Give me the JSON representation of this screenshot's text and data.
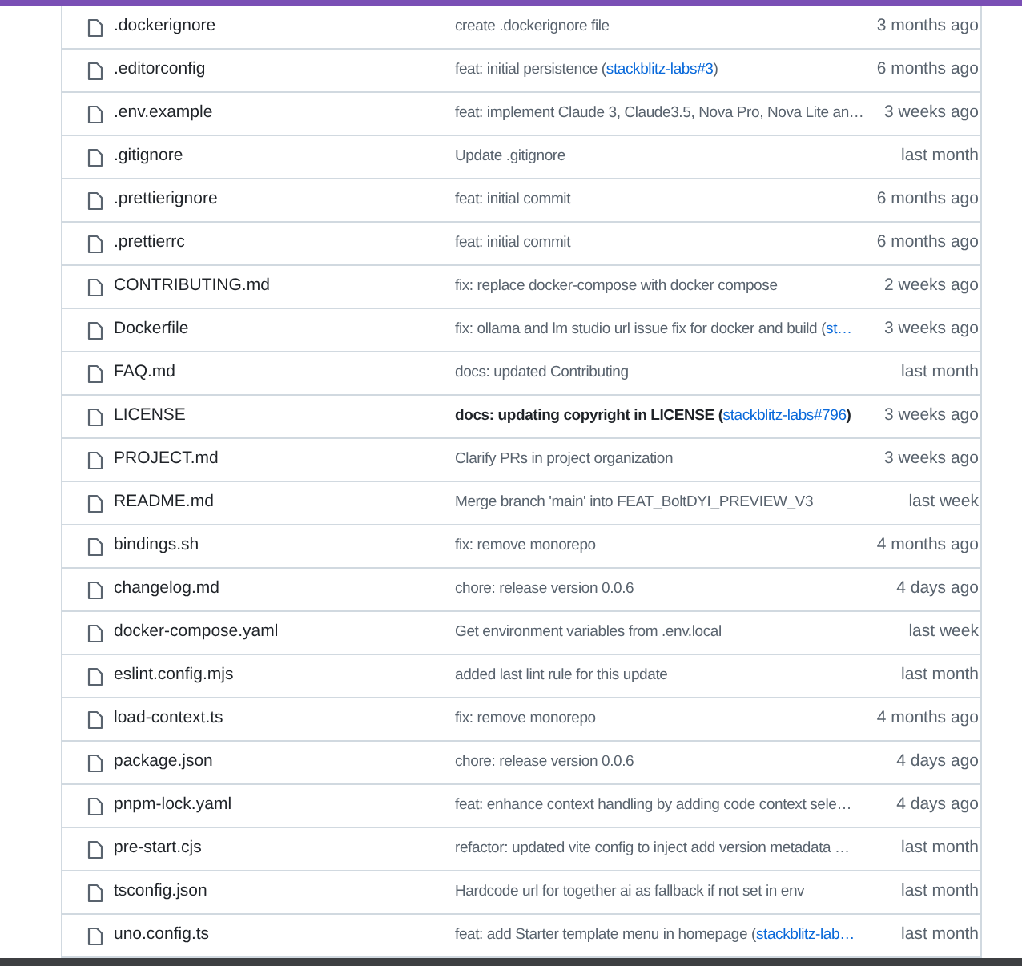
{
  "files": [
    {
      "name": ".dockerignore",
      "commit": [
        {
          "text": "create .dockerignore file"
        }
      ],
      "time": "3 months ago"
    },
    {
      "name": ".editorconfig",
      "commit": [
        {
          "text": "feat: initial persistence ("
        },
        {
          "text": "stackblitz-labs#3",
          "link": true
        },
        {
          "text": ")"
        }
      ],
      "time": "6 months ago"
    },
    {
      "name": ".env.example",
      "commit": [
        {
          "text": "feat: implement Claude 3, Claude3.5, Nova Pro, Nova Lite an…"
        }
      ],
      "time": "3 weeks ago"
    },
    {
      "name": ".gitignore",
      "commit": [
        {
          "text": "Update .gitignore"
        }
      ],
      "time": "last month"
    },
    {
      "name": ".prettierignore",
      "commit": [
        {
          "text": "feat: initial commit"
        }
      ],
      "time": "6 months ago"
    },
    {
      "name": ".prettierrc",
      "commit": [
        {
          "text": "feat: initial commit"
        }
      ],
      "time": "6 months ago"
    },
    {
      "name": "CONTRIBUTING.md",
      "commit": [
        {
          "text": "fix: replace docker-compose with docker compose"
        }
      ],
      "time": "2 weeks ago"
    },
    {
      "name": "Dockerfile",
      "commit": [
        {
          "text": "fix: ollama and lm studio url issue fix for docker and build ("
        },
        {
          "text": "st…",
          "link": true
        }
      ],
      "time": "3 weeks ago"
    },
    {
      "name": "FAQ.md",
      "commit": [
        {
          "text": "docs: updated Contributing"
        }
      ],
      "time": "last month"
    },
    {
      "name": "LICENSE",
      "emphasized": true,
      "commit": [
        {
          "text": "docs: updating copyright in LICENSE ("
        },
        {
          "text": "stackblitz-labs#796",
          "link": true
        },
        {
          "text": ")"
        }
      ],
      "time": "3 weeks ago"
    },
    {
      "name": "PROJECT.md",
      "commit": [
        {
          "text": "Clarify PRs in project organization"
        }
      ],
      "time": "3 weeks ago"
    },
    {
      "name": "README.md",
      "commit": [
        {
          "text": "Merge branch 'main' into FEAT_BoltDYI_PREVIEW_V3"
        }
      ],
      "time": "last week"
    },
    {
      "name": "bindings.sh",
      "commit": [
        {
          "text": "fix: remove monorepo"
        }
      ],
      "time": "4 months ago"
    },
    {
      "name": "changelog.md",
      "commit": [
        {
          "text": "chore: release version 0.0.6"
        }
      ],
      "time": "4 days ago"
    },
    {
      "name": "docker-compose.yaml",
      "commit": [
        {
          "text": "Get environment variables from .env.local"
        }
      ],
      "time": "last week"
    },
    {
      "name": "eslint.config.mjs",
      "commit": [
        {
          "text": "added last lint rule for this update"
        }
      ],
      "time": "last month"
    },
    {
      "name": "load-context.ts",
      "commit": [
        {
          "text": "fix: remove monorepo"
        }
      ],
      "time": "4 months ago"
    },
    {
      "name": "package.json",
      "commit": [
        {
          "text": "chore: release version 0.0.6"
        }
      ],
      "time": "4 days ago"
    },
    {
      "name": "pnpm-lock.yaml",
      "commit": [
        {
          "text": "feat: enhance context handling by adding code context sele…"
        }
      ],
      "time": "4 days ago"
    },
    {
      "name": "pre-start.cjs",
      "commit": [
        {
          "text": "refactor: updated vite config to inject add version metadata …"
        }
      ],
      "time": "last month"
    },
    {
      "name": "tsconfig.json",
      "commit": [
        {
          "text": "Hardcode url for together ai as fallback if not set in env"
        }
      ],
      "time": "last month"
    },
    {
      "name": "uno.config.ts",
      "commit": [
        {
          "text": "feat: add Starter template menu in homepage ("
        },
        {
          "text": "stackblitz-lab…",
          "link": true
        }
      ],
      "time": "last month"
    }
  ]
}
